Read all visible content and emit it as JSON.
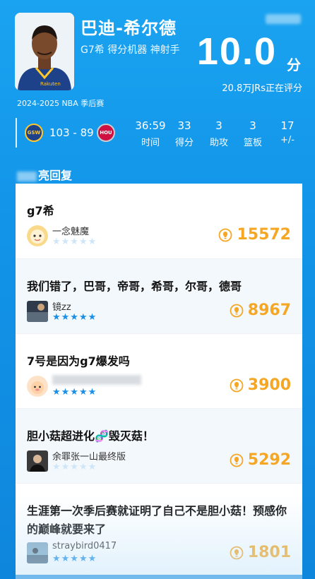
{
  "header": {
    "player_name": "巴迪-希尔德",
    "player_tags": "G7希 得分机器 神射手",
    "score": "10.0",
    "score_unit": "分",
    "raters": "20.8万JRs正在评分",
    "season": "2024-2025 NBA 季后赛"
  },
  "game": {
    "home_abbr": "GSW",
    "away_abbr": "HOU",
    "score": "103 - 89",
    "stats": [
      {
        "value": "36:59",
        "label": "时间"
      },
      {
        "value": "33",
        "label": "得分"
      },
      {
        "value": "3",
        "label": "助攻"
      },
      {
        "value": "3",
        "label": "篮板"
      },
      {
        "value": "17",
        "label": "+/-"
      }
    ]
  },
  "section": {
    "title": "亮回复"
  },
  "comments": [
    {
      "text": "g7希",
      "user": "一念魅魔",
      "stars": 0,
      "likes": "15572"
    },
    {
      "text": "我们错了，巴哥，帝哥，希哥，尔哥，德哥",
      "user": "镜zz",
      "stars": 5,
      "likes": "8967"
    },
    {
      "text": "7号是因为g7爆发吗",
      "user": "",
      "stars": 5,
      "likes": "3900"
    },
    {
      "text": "胆小菇超进化🧬毁灭菇！",
      "user": "余罪张一山最终版",
      "stars": 0,
      "likes": "5292"
    },
    {
      "text": "生涯第一次季后赛就证明了自己不是胆小菇！预感你的巅峰就要来了",
      "user": "straybird0417",
      "stars": 5,
      "likes": "1801"
    }
  ],
  "colors": {
    "accent": "#1b8fe6",
    "likes": "#f5a623",
    "bg": "#1aa3f0"
  }
}
